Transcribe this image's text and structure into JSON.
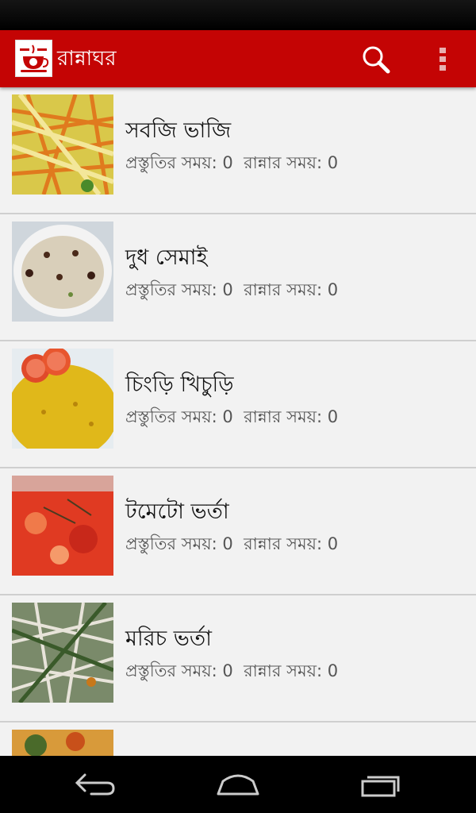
{
  "app": {
    "title": "রান্নাঘর",
    "logo_text": "রান্না ঘর",
    "accent_color": "#c40404"
  },
  "toolbar": {
    "search_icon": "search-icon",
    "overflow_icon": "overflow-menu-icon"
  },
  "recipes": [
    {
      "name": "সবজি ভাজি",
      "meta": "প্রস্তুতির সময়: 0  রান্নার সময়: 0"
    },
    {
      "name": "দুধ সেমাই",
      "meta": "প্রস্তুতির সময়: 0  রান্নার সময়: 0"
    },
    {
      "name": "চিংড়ি খিচুড়ি",
      "meta": "প্রস্তুতির সময়: 0  রান্নার সময়: 0"
    },
    {
      "name": "টমেটো ভর্তা",
      "meta": "প্রস্তুতির সময়: 0  রান্নার সময়: 0"
    },
    {
      "name": "মরিচ ভর্তা",
      "meta": "প্রস্তুতির সময়: 0  রান্নার সময়: 0"
    },
    {
      "name": "",
      "meta": ""
    }
  ],
  "navigation": {
    "back_icon": "back-icon",
    "home_icon": "home-icon",
    "recents_icon": "recent-apps-icon"
  }
}
